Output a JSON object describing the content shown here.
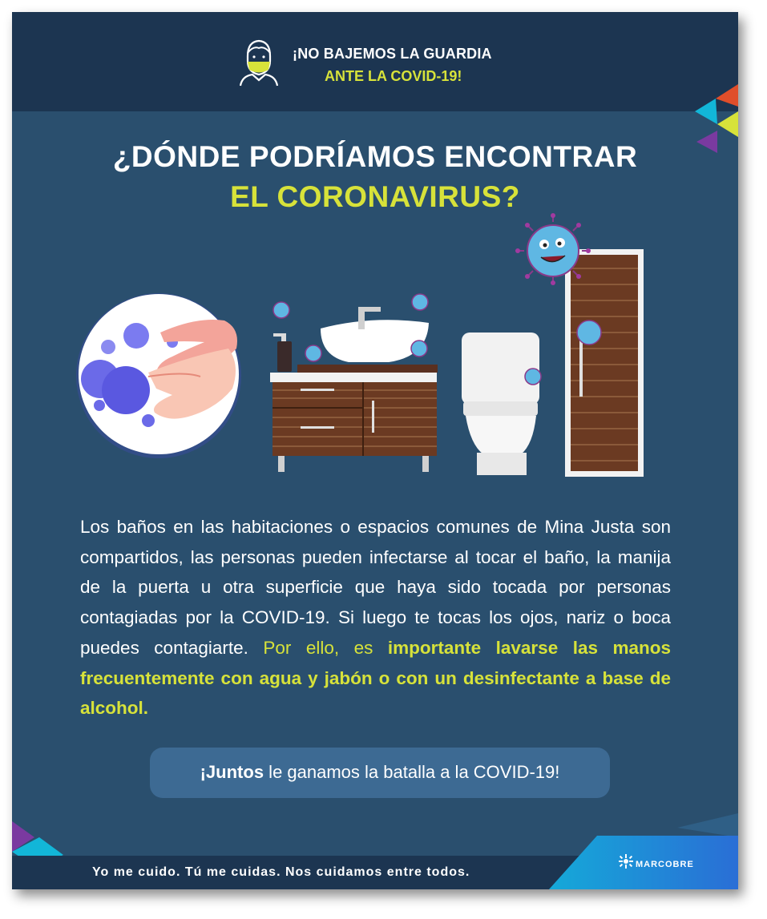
{
  "header": {
    "line1": "¡NO BAJEMOS LA GUARDIA",
    "line2": "ANTE LA COVID-19!"
  },
  "title": {
    "line1": "¿DÓNDE PODRÍAMOS ENCONTRAR",
    "line2": "EL CORONAVIRUS?"
  },
  "body": {
    "normal": "Los baños en las habitaciones o espacios comunes de Mina Justa son compartidos, las personas pueden infectarse al tocar el baño, la manija de la puerta u otra superficie que haya sido tocada por personas contagiadas por la COVID-19. Si luego te tocas los ojos, nariz o boca puedes contagiarte. ",
    "highlight": "Por ello, es ",
    "highlight_bold": "importante lavarse las manos frecuentemente con agua y jabón o con un desinfectante a base de alcohol."
  },
  "cta": {
    "bold": "¡Juntos",
    "rest": " le ganamos la batalla a la COVID-19!"
  },
  "footer": {
    "slogan": "Yo me cuido. Tú me cuidas. Nos cuidamos entre todos.",
    "logo": "MARCOBRE"
  },
  "colors": {
    "background": "#2a4f6e",
    "header": "#1c3551",
    "accent": "#d7e23a",
    "pill": "#3d6a93"
  },
  "icons": [
    "mask-face-icon",
    "hand-washing-icon",
    "virus-icon",
    "sink-icon",
    "toilet-icon",
    "door-icon",
    "marcobre-logo-icon"
  ]
}
